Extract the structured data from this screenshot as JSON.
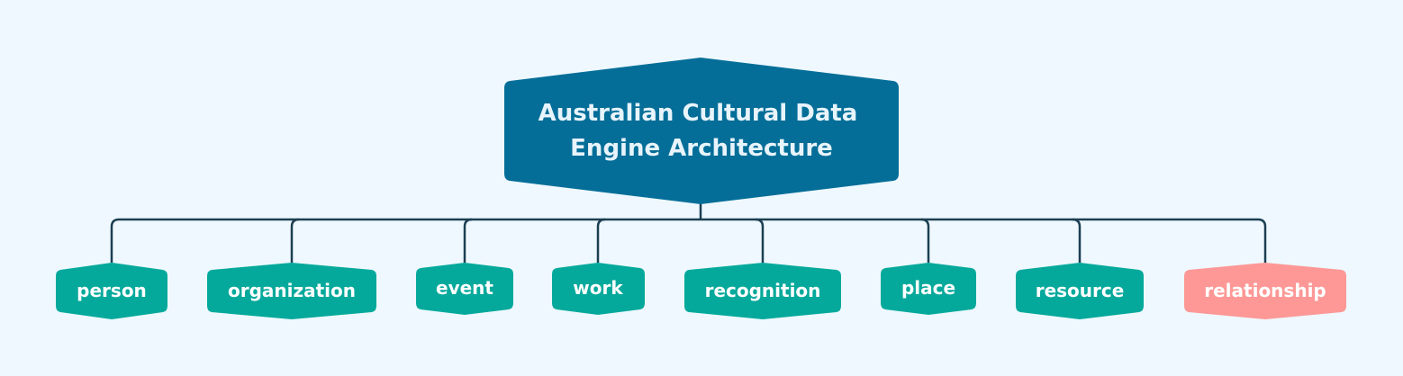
{
  "diagram": {
    "root": {
      "title_line1": "Australian Cultural Data",
      "title_line2": "Engine Architecture",
      "color": "#046e98"
    },
    "children": [
      {
        "id": "person",
        "label": "person",
        "color": "#05a99b"
      },
      {
        "id": "organization",
        "label": "organization",
        "color": "#05a99b"
      },
      {
        "id": "event",
        "label": "event",
        "color": "#05a99b"
      },
      {
        "id": "work",
        "label": "work",
        "color": "#05a99b"
      },
      {
        "id": "recognition",
        "label": "recognition",
        "color": "#05a99b"
      },
      {
        "id": "place",
        "label": "place",
        "color": "#05a99b"
      },
      {
        "id": "resource",
        "label": "resource",
        "color": "#05a99b"
      },
      {
        "id": "relationship",
        "label": "relationship",
        "color": "#fd9896"
      }
    ],
    "connector_color": "#1c3f52",
    "background": "#eef8fe"
  }
}
